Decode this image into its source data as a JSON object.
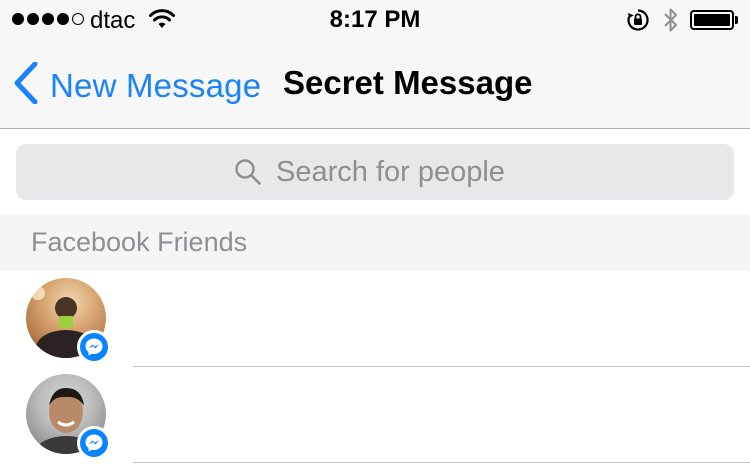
{
  "status_bar": {
    "signal_bars_filled": 4,
    "signal_bars_total": 5,
    "carrier": "dtac",
    "time": "8:17 PM"
  },
  "nav": {
    "back_label": "New Message",
    "title": "Secret Message"
  },
  "search": {
    "placeholder": "Search for people",
    "value": ""
  },
  "section": {
    "title": "Facebook Friends"
  },
  "friends": [
    {
      "name": "",
      "badge": "messenger-badge"
    },
    {
      "name": "",
      "badge": "messenger-badge"
    }
  ],
  "colors": {
    "accent": "#1a82fb",
    "messenger_badge": "#0a84ff",
    "bar_background": "#f7f7f7",
    "search_background": "#e8e8ea",
    "section_background": "#f5f5f5",
    "secondary_text": "#8e8e93"
  }
}
